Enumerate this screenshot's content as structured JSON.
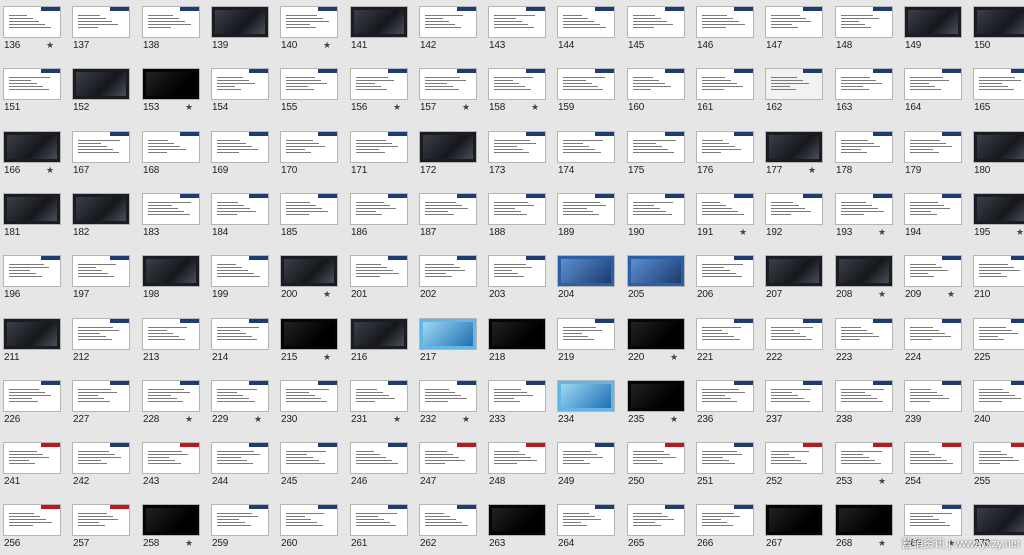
{
  "slides": [
    {
      "number": "136",
      "starred": true,
      "style": "white"
    },
    {
      "number": "137",
      "starred": false,
      "style": "white"
    },
    {
      "number": "138",
      "starred": false,
      "style": "white"
    },
    {
      "number": "139",
      "starred": false,
      "style": "dark"
    },
    {
      "number": "140",
      "starred": true,
      "style": "white"
    },
    {
      "number": "141",
      "starred": false,
      "style": "dark"
    },
    {
      "number": "142",
      "starred": false,
      "style": "white"
    },
    {
      "number": "143",
      "starred": false,
      "style": "white"
    },
    {
      "number": "144",
      "starred": false,
      "style": "white"
    },
    {
      "number": "145",
      "starred": false,
      "style": "white"
    },
    {
      "number": "146",
      "starred": false,
      "style": "white"
    },
    {
      "number": "147",
      "starred": false,
      "style": "white"
    },
    {
      "number": "148",
      "starred": false,
      "style": "white"
    },
    {
      "number": "149",
      "starred": false,
      "style": "dark"
    },
    {
      "number": "150",
      "starred": false,
      "style": "dark"
    },
    {
      "number": "151",
      "starred": false,
      "style": "white"
    },
    {
      "number": "152",
      "starred": false,
      "style": "dark"
    },
    {
      "number": "153",
      "starred": true,
      "style": "black"
    },
    {
      "number": "154",
      "starred": false,
      "style": "white"
    },
    {
      "number": "155",
      "starred": false,
      "style": "white"
    },
    {
      "number": "156",
      "starred": true,
      "style": "white"
    },
    {
      "number": "157",
      "starred": true,
      "style": "white"
    },
    {
      "number": "158",
      "starred": true,
      "style": "white"
    },
    {
      "number": "159",
      "starred": false,
      "style": "white"
    },
    {
      "number": "160",
      "starred": false,
      "style": "white"
    },
    {
      "number": "161",
      "starred": false,
      "style": "white"
    },
    {
      "number": "162",
      "starred": false,
      "style": "gray"
    },
    {
      "number": "163",
      "starred": false,
      "style": "white"
    },
    {
      "number": "164",
      "starred": false,
      "style": "white"
    },
    {
      "number": "165",
      "starred": false,
      "style": "white"
    },
    {
      "number": "166",
      "starred": true,
      "style": "dark"
    },
    {
      "number": "167",
      "starred": false,
      "style": "white"
    },
    {
      "number": "168",
      "starred": false,
      "style": "white"
    },
    {
      "number": "169",
      "starred": false,
      "style": "white"
    },
    {
      "number": "170",
      "starred": false,
      "style": "white"
    },
    {
      "number": "171",
      "starred": false,
      "style": "white"
    },
    {
      "number": "172",
      "starred": false,
      "style": "dark"
    },
    {
      "number": "173",
      "starred": false,
      "style": "white"
    },
    {
      "number": "174",
      "starred": false,
      "style": "white"
    },
    {
      "number": "175",
      "starred": false,
      "style": "white"
    },
    {
      "number": "176",
      "starred": false,
      "style": "white"
    },
    {
      "number": "177",
      "starred": true,
      "style": "dark"
    },
    {
      "number": "178",
      "starred": false,
      "style": "white"
    },
    {
      "number": "179",
      "starred": false,
      "style": "white"
    },
    {
      "number": "180",
      "starred": false,
      "style": "dark"
    },
    {
      "number": "181",
      "starred": false,
      "style": "dark"
    },
    {
      "number": "182",
      "starred": false,
      "style": "dark"
    },
    {
      "number": "183",
      "starred": false,
      "style": "white"
    },
    {
      "number": "184",
      "starred": false,
      "style": "white"
    },
    {
      "number": "185",
      "starred": false,
      "style": "white"
    },
    {
      "number": "186",
      "starred": false,
      "style": "white"
    },
    {
      "number": "187",
      "starred": false,
      "style": "white"
    },
    {
      "number": "188",
      "starred": false,
      "style": "white"
    },
    {
      "number": "189",
      "starred": false,
      "style": "white"
    },
    {
      "number": "190",
      "starred": false,
      "style": "white"
    },
    {
      "number": "191",
      "starred": true,
      "style": "white"
    },
    {
      "number": "192",
      "starred": false,
      "style": "white"
    },
    {
      "number": "193",
      "starred": true,
      "style": "white"
    },
    {
      "number": "194",
      "starred": false,
      "style": "white"
    },
    {
      "number": "195",
      "starred": true,
      "style": "dark"
    },
    {
      "number": "196",
      "starred": false,
      "style": "white"
    },
    {
      "number": "197",
      "starred": false,
      "style": "white"
    },
    {
      "number": "198",
      "starred": false,
      "style": "dark"
    },
    {
      "number": "199",
      "starred": false,
      "style": "white"
    },
    {
      "number": "200",
      "starred": true,
      "style": "dark"
    },
    {
      "number": "201",
      "starred": false,
      "style": "white"
    },
    {
      "number": "202",
      "starred": false,
      "style": "white"
    },
    {
      "number": "203",
      "starred": false,
      "style": "white"
    },
    {
      "number": "204",
      "starred": false,
      "style": "blue"
    },
    {
      "number": "205",
      "starred": false,
      "style": "blue"
    },
    {
      "number": "206",
      "starred": false,
      "style": "white"
    },
    {
      "number": "207",
      "starred": false,
      "style": "dark"
    },
    {
      "number": "208",
      "starred": true,
      "style": "dark"
    },
    {
      "number": "209",
      "starred": true,
      "style": "white"
    },
    {
      "number": "210",
      "starred": false,
      "style": "white"
    },
    {
      "number": "211",
      "starred": false,
      "style": "dark"
    },
    {
      "number": "212",
      "starred": false,
      "style": "white"
    },
    {
      "number": "213",
      "starred": false,
      "style": "white"
    },
    {
      "number": "214",
      "starred": false,
      "style": "white"
    },
    {
      "number": "215",
      "starred": true,
      "style": "black"
    },
    {
      "number": "216",
      "starred": false,
      "style": "dark"
    },
    {
      "number": "217",
      "starred": false,
      "style": "cyan"
    },
    {
      "number": "218",
      "starred": false,
      "style": "black"
    },
    {
      "number": "219",
      "starred": false,
      "style": "white"
    },
    {
      "number": "220",
      "starred": true,
      "style": "black"
    },
    {
      "number": "221",
      "starred": false,
      "style": "white"
    },
    {
      "number": "222",
      "starred": false,
      "style": "white"
    },
    {
      "number": "223",
      "starred": false,
      "style": "white"
    },
    {
      "number": "224",
      "starred": false,
      "style": "white"
    },
    {
      "number": "225",
      "starred": false,
      "style": "white"
    },
    {
      "number": "226",
      "starred": false,
      "style": "white"
    },
    {
      "number": "227",
      "starred": false,
      "style": "white"
    },
    {
      "number": "228",
      "starred": true,
      "style": "white"
    },
    {
      "number": "229",
      "starred": true,
      "style": "white"
    },
    {
      "number": "230",
      "starred": false,
      "style": "white"
    },
    {
      "number": "231",
      "starred": true,
      "style": "white"
    },
    {
      "number": "232",
      "starred": true,
      "style": "white"
    },
    {
      "number": "233",
      "starred": false,
      "style": "white"
    },
    {
      "number": "234",
      "starred": false,
      "style": "cyan"
    },
    {
      "number": "235",
      "starred": true,
      "style": "black"
    },
    {
      "number": "236",
      "starred": false,
      "style": "white"
    },
    {
      "number": "237",
      "starred": false,
      "style": "white"
    },
    {
      "number": "238",
      "starred": false,
      "style": "white"
    },
    {
      "number": "239",
      "starred": false,
      "style": "white"
    },
    {
      "number": "240",
      "starred": false,
      "style": "white"
    },
    {
      "number": "241",
      "starred": false,
      "style": "red"
    },
    {
      "number": "242",
      "starred": false,
      "style": "white"
    },
    {
      "number": "243",
      "starred": false,
      "style": "red"
    },
    {
      "number": "244",
      "starred": false,
      "style": "white"
    },
    {
      "number": "245",
      "starred": false,
      "style": "white"
    },
    {
      "number": "246",
      "starred": false,
      "style": "white"
    },
    {
      "number": "247",
      "starred": false,
      "style": "red"
    },
    {
      "number": "248",
      "starred": false,
      "style": "red"
    },
    {
      "number": "249",
      "starred": false,
      "style": "white"
    },
    {
      "number": "250",
      "starred": false,
      "style": "red"
    },
    {
      "number": "251",
      "starred": false,
      "style": "white"
    },
    {
      "number": "252",
      "starred": false,
      "style": "red"
    },
    {
      "number": "253",
      "starred": true,
      "style": "red"
    },
    {
      "number": "254",
      "starred": false,
      "style": "red"
    },
    {
      "number": "255",
      "starred": false,
      "style": "red"
    },
    {
      "number": "256",
      "starred": false,
      "style": "red"
    },
    {
      "number": "257",
      "starred": false,
      "style": "red"
    },
    {
      "number": "258",
      "starred": true,
      "style": "black"
    },
    {
      "number": "259",
      "starred": false,
      "style": "white"
    },
    {
      "number": "260",
      "starred": false,
      "style": "white"
    },
    {
      "number": "261",
      "starred": false,
      "style": "white"
    },
    {
      "number": "262",
      "starred": false,
      "style": "white"
    },
    {
      "number": "263",
      "starred": false,
      "style": "black"
    },
    {
      "number": "264",
      "starred": false,
      "style": "white"
    },
    {
      "number": "265",
      "starred": false,
      "style": "white"
    },
    {
      "number": "266",
      "starred": false,
      "style": "white"
    },
    {
      "number": "267",
      "starred": false,
      "style": "black"
    },
    {
      "number": "268",
      "starred": true,
      "style": "black"
    },
    {
      "number": "269",
      "starred": true,
      "style": "white"
    },
    {
      "number": "270",
      "starred": false,
      "style": "dark"
    }
  ],
  "star_glyph": "★",
  "watermark": "营销资讯 | www.yxzy.net"
}
